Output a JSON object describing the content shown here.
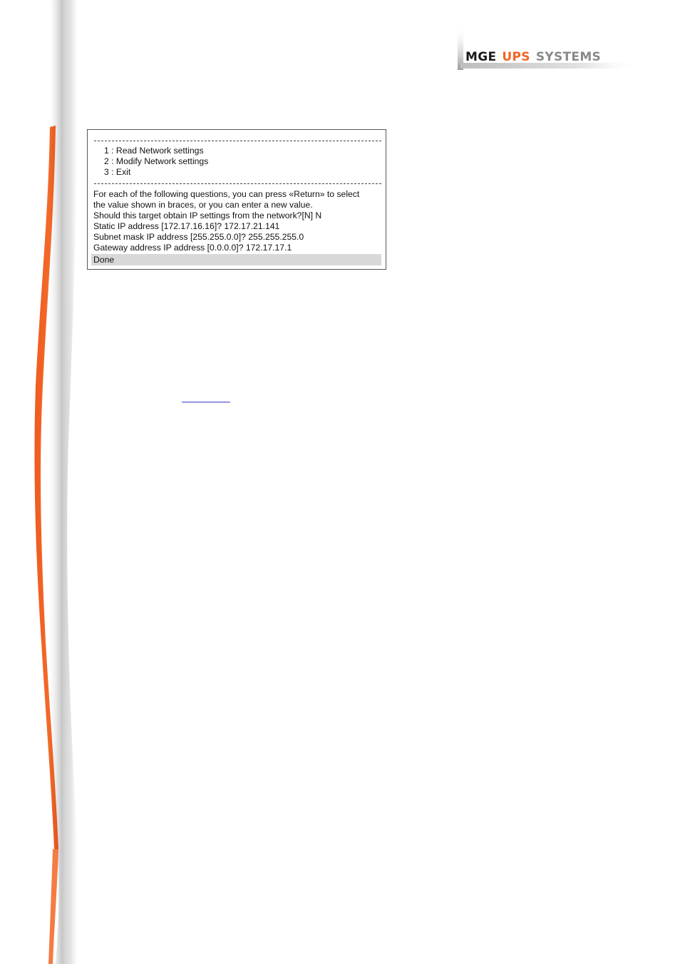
{
  "header": {
    "logo": {
      "word1": "MGE",
      "word2": "UPS",
      "word3": "SYSTEMS"
    }
  },
  "terminal": {
    "menu": [
      {
        "label": "1 : Read Network settings"
      },
      {
        "label": "2 : Modify Network settings"
      },
      {
        "label": "3 : Exit"
      }
    ],
    "lines": [
      {
        "text": "For each of the following questions, you can press «Return» to select"
      },
      {
        "text": "the value shown in braces, or you can enter a new value."
      },
      {
        "text": "Should this target obtain IP settings from the network?[N] N"
      },
      {
        "text": "Static IP address [172.17.16.16]? 172.17.21.141"
      },
      {
        "text": "Subnet mask IP address [255.255.0.0]? 255.255.255.0"
      },
      {
        "text": "Gateway address IP address [0.0.0.0]? 172.17.17.1"
      }
    ],
    "status": "Done"
  },
  "colors": {
    "brand_orange": "#f26522",
    "brand_grey": "#8a8a8a",
    "highlight": "#d8d8d8"
  }
}
